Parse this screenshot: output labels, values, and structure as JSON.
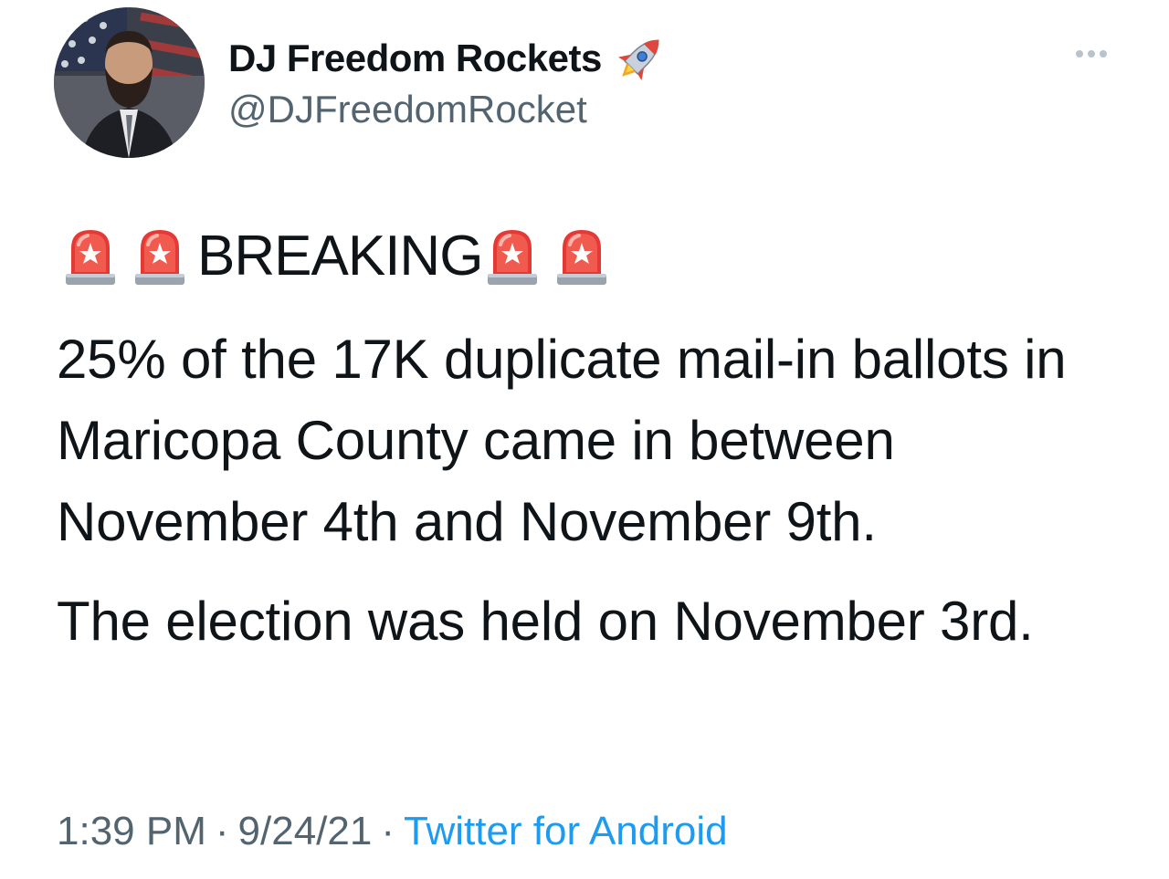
{
  "author": {
    "display_name": "DJ Freedom Rockets",
    "name_emoji": "rocket-icon",
    "handle": "@DJFreedomRocket"
  },
  "tweet": {
    "headline": "BREAKING",
    "headline_emoji": "police-car-light-icon",
    "paragraph_1": "25% of the 17K duplicate mail-in ballots in Maricopa County came in between November 4th and November 9th.",
    "paragraph_2": "The election was held on November 3rd."
  },
  "meta": {
    "time": "1:39 PM",
    "separator": "·",
    "date": "9/24/21",
    "source": "Twitter for Android"
  },
  "colors": {
    "text_primary": "#0f1419",
    "text_secondary": "#536471",
    "link": "#1d9bf0"
  }
}
